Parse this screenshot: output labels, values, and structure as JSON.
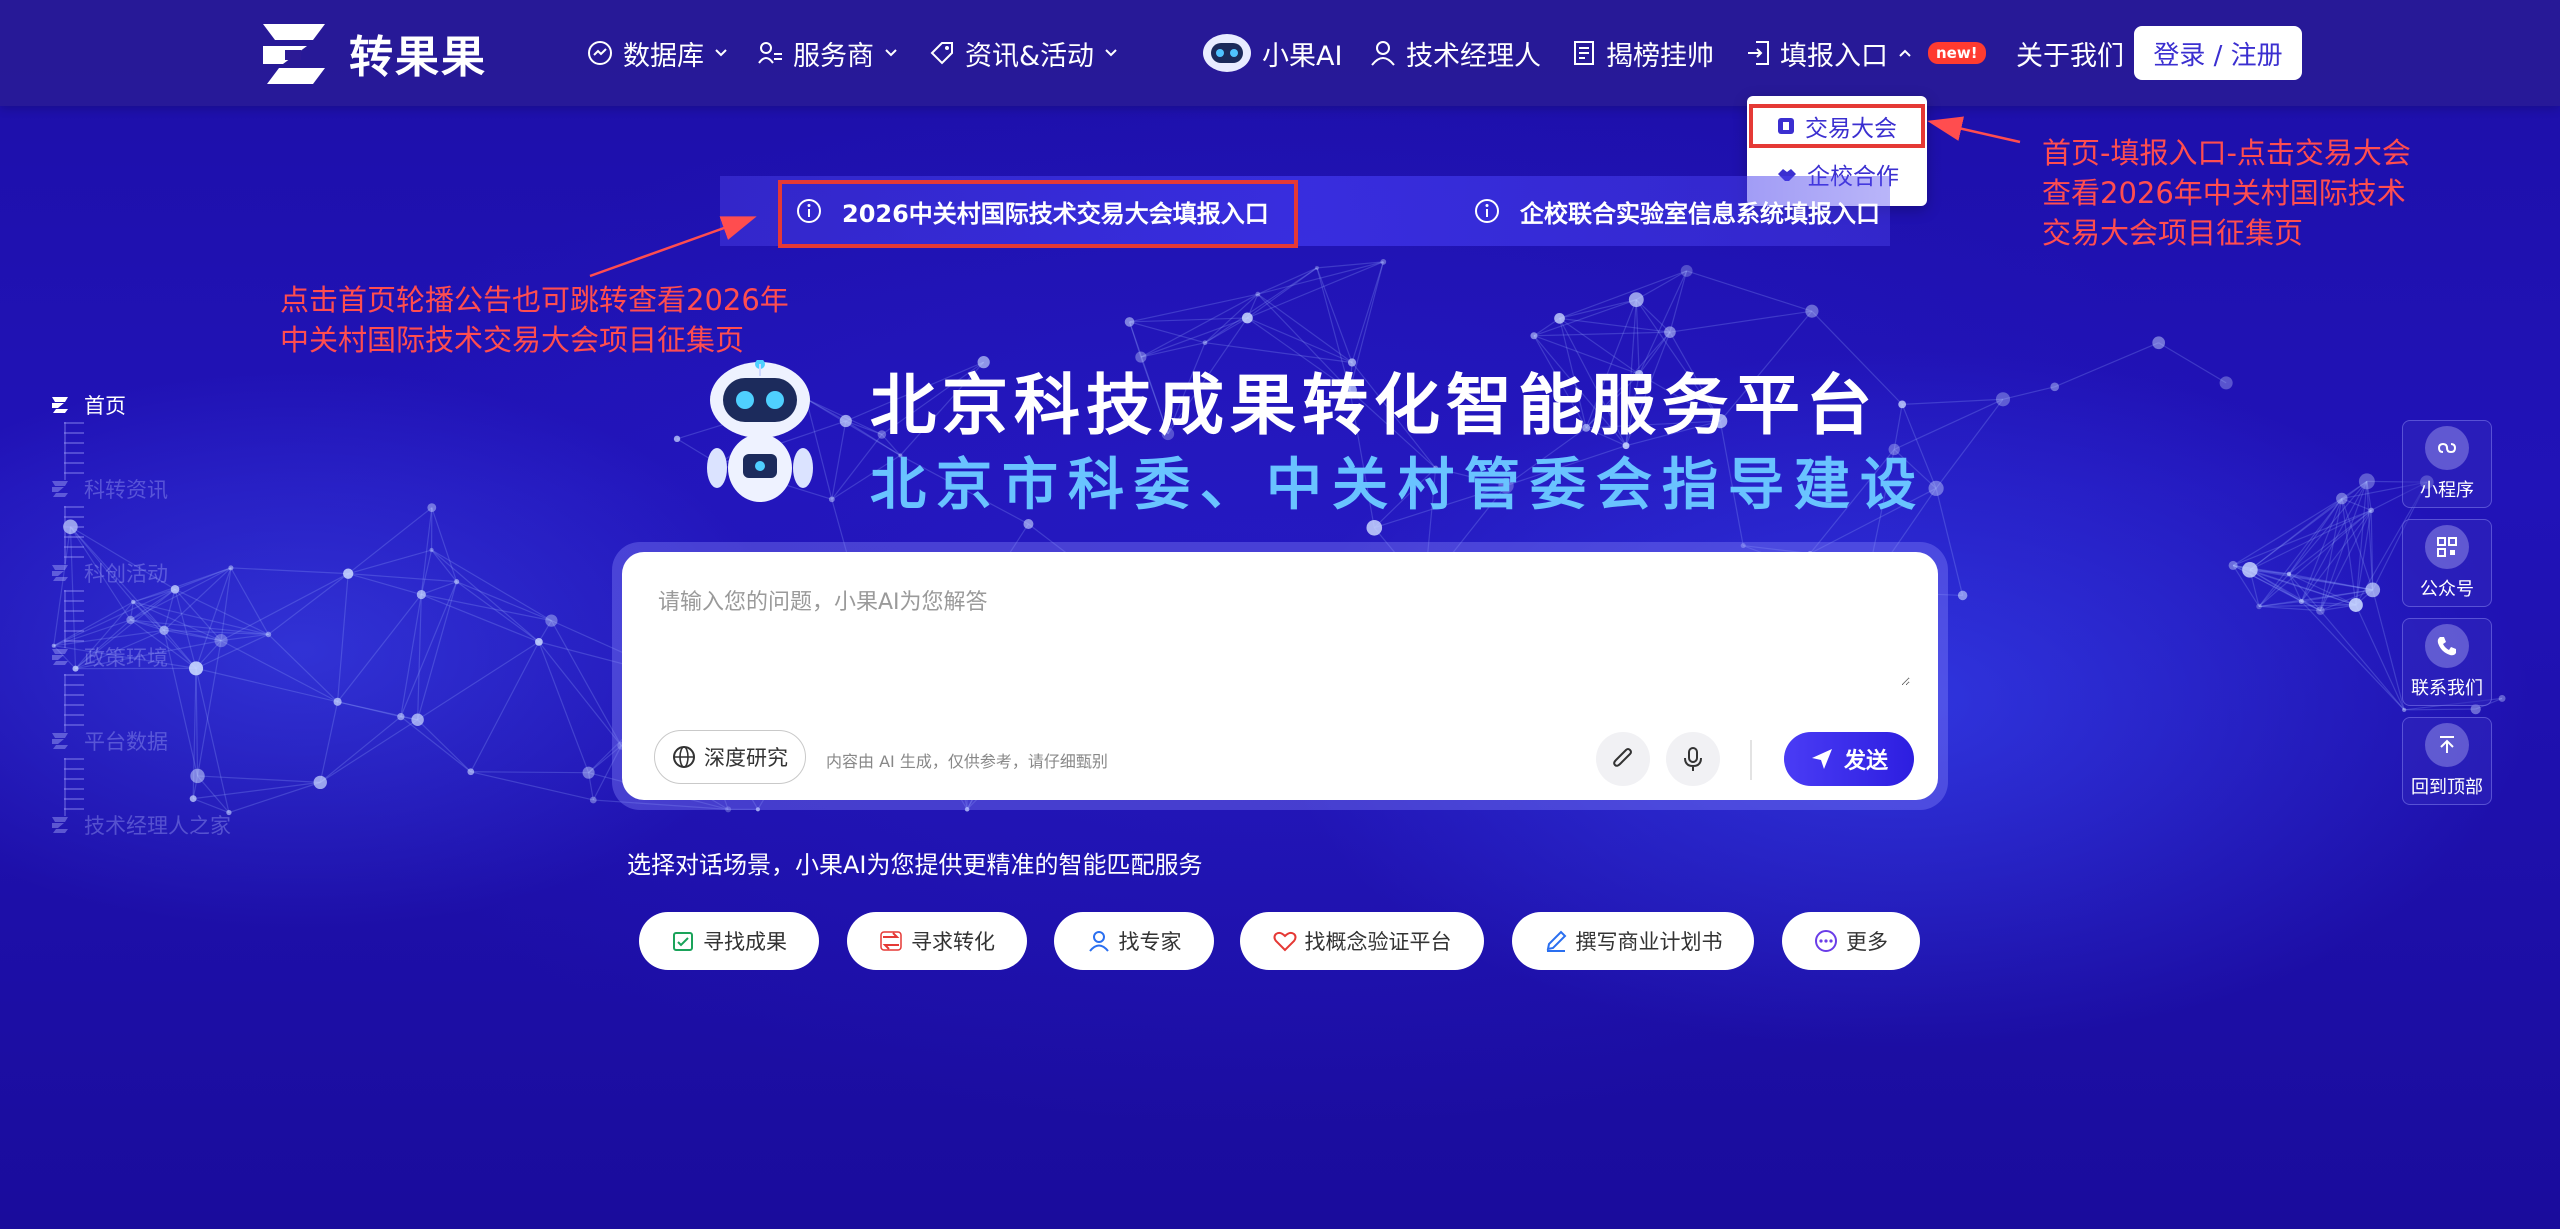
{
  "brand": {
    "name": "转果果"
  },
  "nav": {
    "database": "数据库",
    "service_provider": "服务商",
    "news_events": "资讯&活动",
    "ai": "小果AI",
    "tech_manager": "技术经理人",
    "bounty": "揭榜挂帅",
    "report_entry": "填报入口",
    "new_badge": "new!",
    "about": "关于我们",
    "login": "登录 / 注册"
  },
  "dropdown": {
    "items": [
      "交易大会",
      "企校合作"
    ]
  },
  "notices": [
    "2026中关村国际技术交易大会填报入口",
    "企校联合实验室信息系统填报入口"
  ],
  "annotations": {
    "left_line1": "点击首页轮播公告也可跳转查看2026年",
    "left_line2": "中关村国际技术交易大会项目征集页",
    "right_line1": "首页-填报入口-点击交易大会",
    "right_line2": "查看2026年中关村国际技术",
    "right_line3": "交易大会项目征集页"
  },
  "hero": {
    "title": "北京科技成果转化智能服务平台",
    "subtitle": "北京市科委、中关村管委会指导建设"
  },
  "side_nav": [
    "首页",
    "科转资讯",
    "科创活动",
    "政策环境",
    "平台数据",
    "技术经理人之家"
  ],
  "chat": {
    "placeholder": "请输入您的问题，小果AI为您解答",
    "deep_research": "深度研究",
    "disclaimer": "内容由 AI 生成，仅供参考，请仔细甄别",
    "send": "发送"
  },
  "scene_hint": "选择对话场景，小果AI为您提供更精准的智能匹配服务",
  "chips": [
    "寻找成果",
    "寻求转化",
    "找专家",
    "找概念验证平台",
    "撰写商业计划书",
    "更多"
  ],
  "right_float": [
    "小程序",
    "公众号",
    "联系我们",
    "回到顶部"
  ],
  "colors": {
    "accent": "#3b2fd0",
    "annotation": "#ff4d4f",
    "subtitle": "#69c3ff"
  }
}
